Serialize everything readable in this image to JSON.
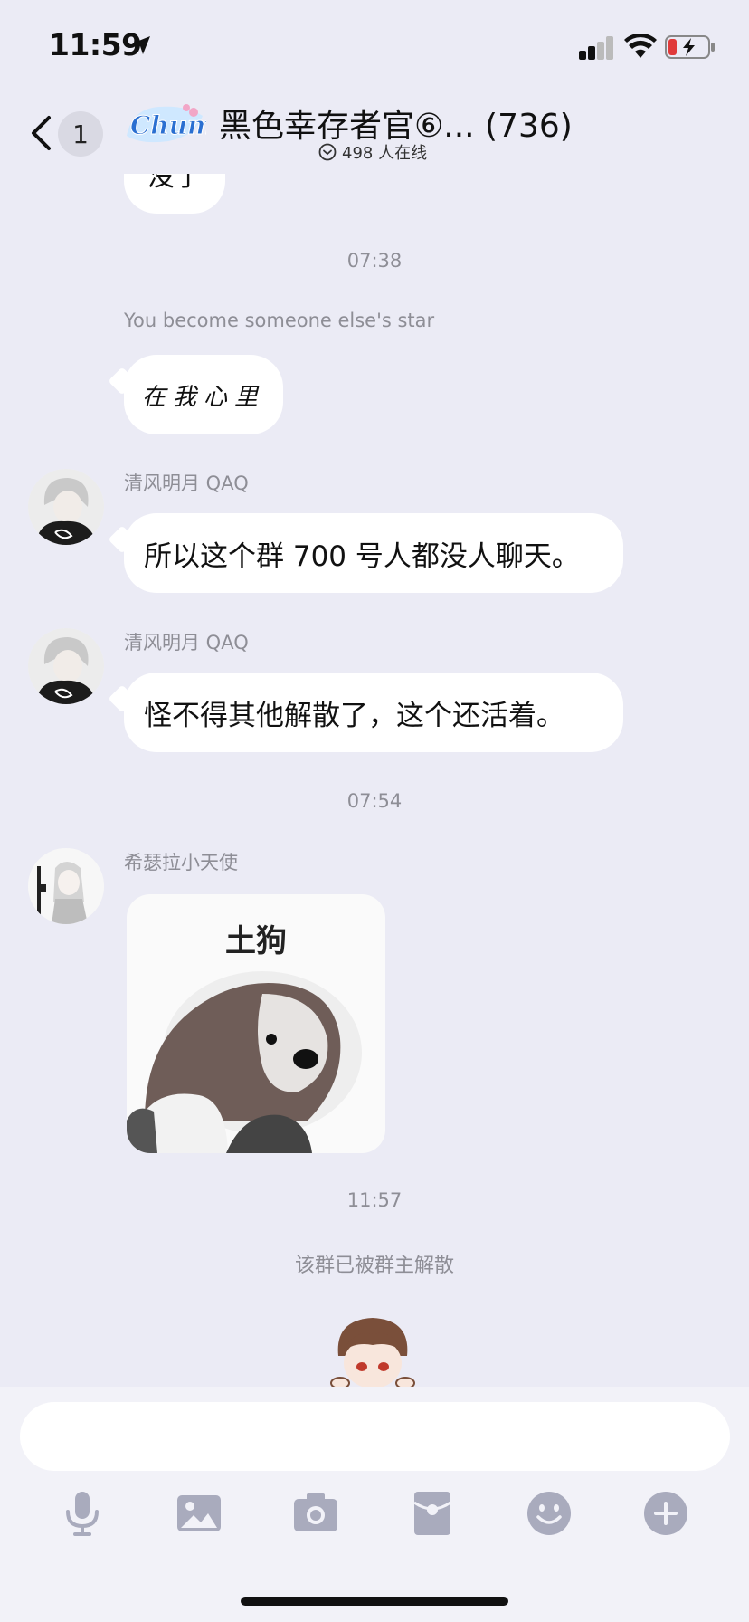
{
  "status_bar": {
    "time": "11:59"
  },
  "header": {
    "back_count": "1",
    "logo_text": "Chum",
    "title": "黑色幸存者官⑥... (736)",
    "online": "498 人在线"
  },
  "chat": {
    "partial_message": "没了",
    "time_1": "07:38",
    "signature": "You become someone else's star",
    "handwritten_text": "在我心里",
    "messages": [
      {
        "sender": "清风明月 QAQ",
        "text": "所以这个群 700 号人都没人聊天。"
      },
      {
        "sender": "清风明月 QAQ",
        "text": "怪不得其他解散了，这个还活着。"
      }
    ],
    "time_2": "07:54",
    "sticker_sender": "希瑟拉小天使",
    "sticker_caption": "土狗",
    "time_3": "11:57",
    "system_note": "该群已被群主解散"
  },
  "input": {
    "placeholder": ""
  },
  "toolbar": {
    "icons": [
      "microphone-icon",
      "image-icon",
      "camera-icon",
      "red-packet-icon",
      "emoji-icon",
      "plus-icon"
    ]
  },
  "colors": {
    "background": "#ebebf5",
    "bubble": "#ffffff",
    "meta_text": "#8e8e96",
    "battery_low": "#e03a3a",
    "toolbar_icon": "#a9abbd"
  }
}
